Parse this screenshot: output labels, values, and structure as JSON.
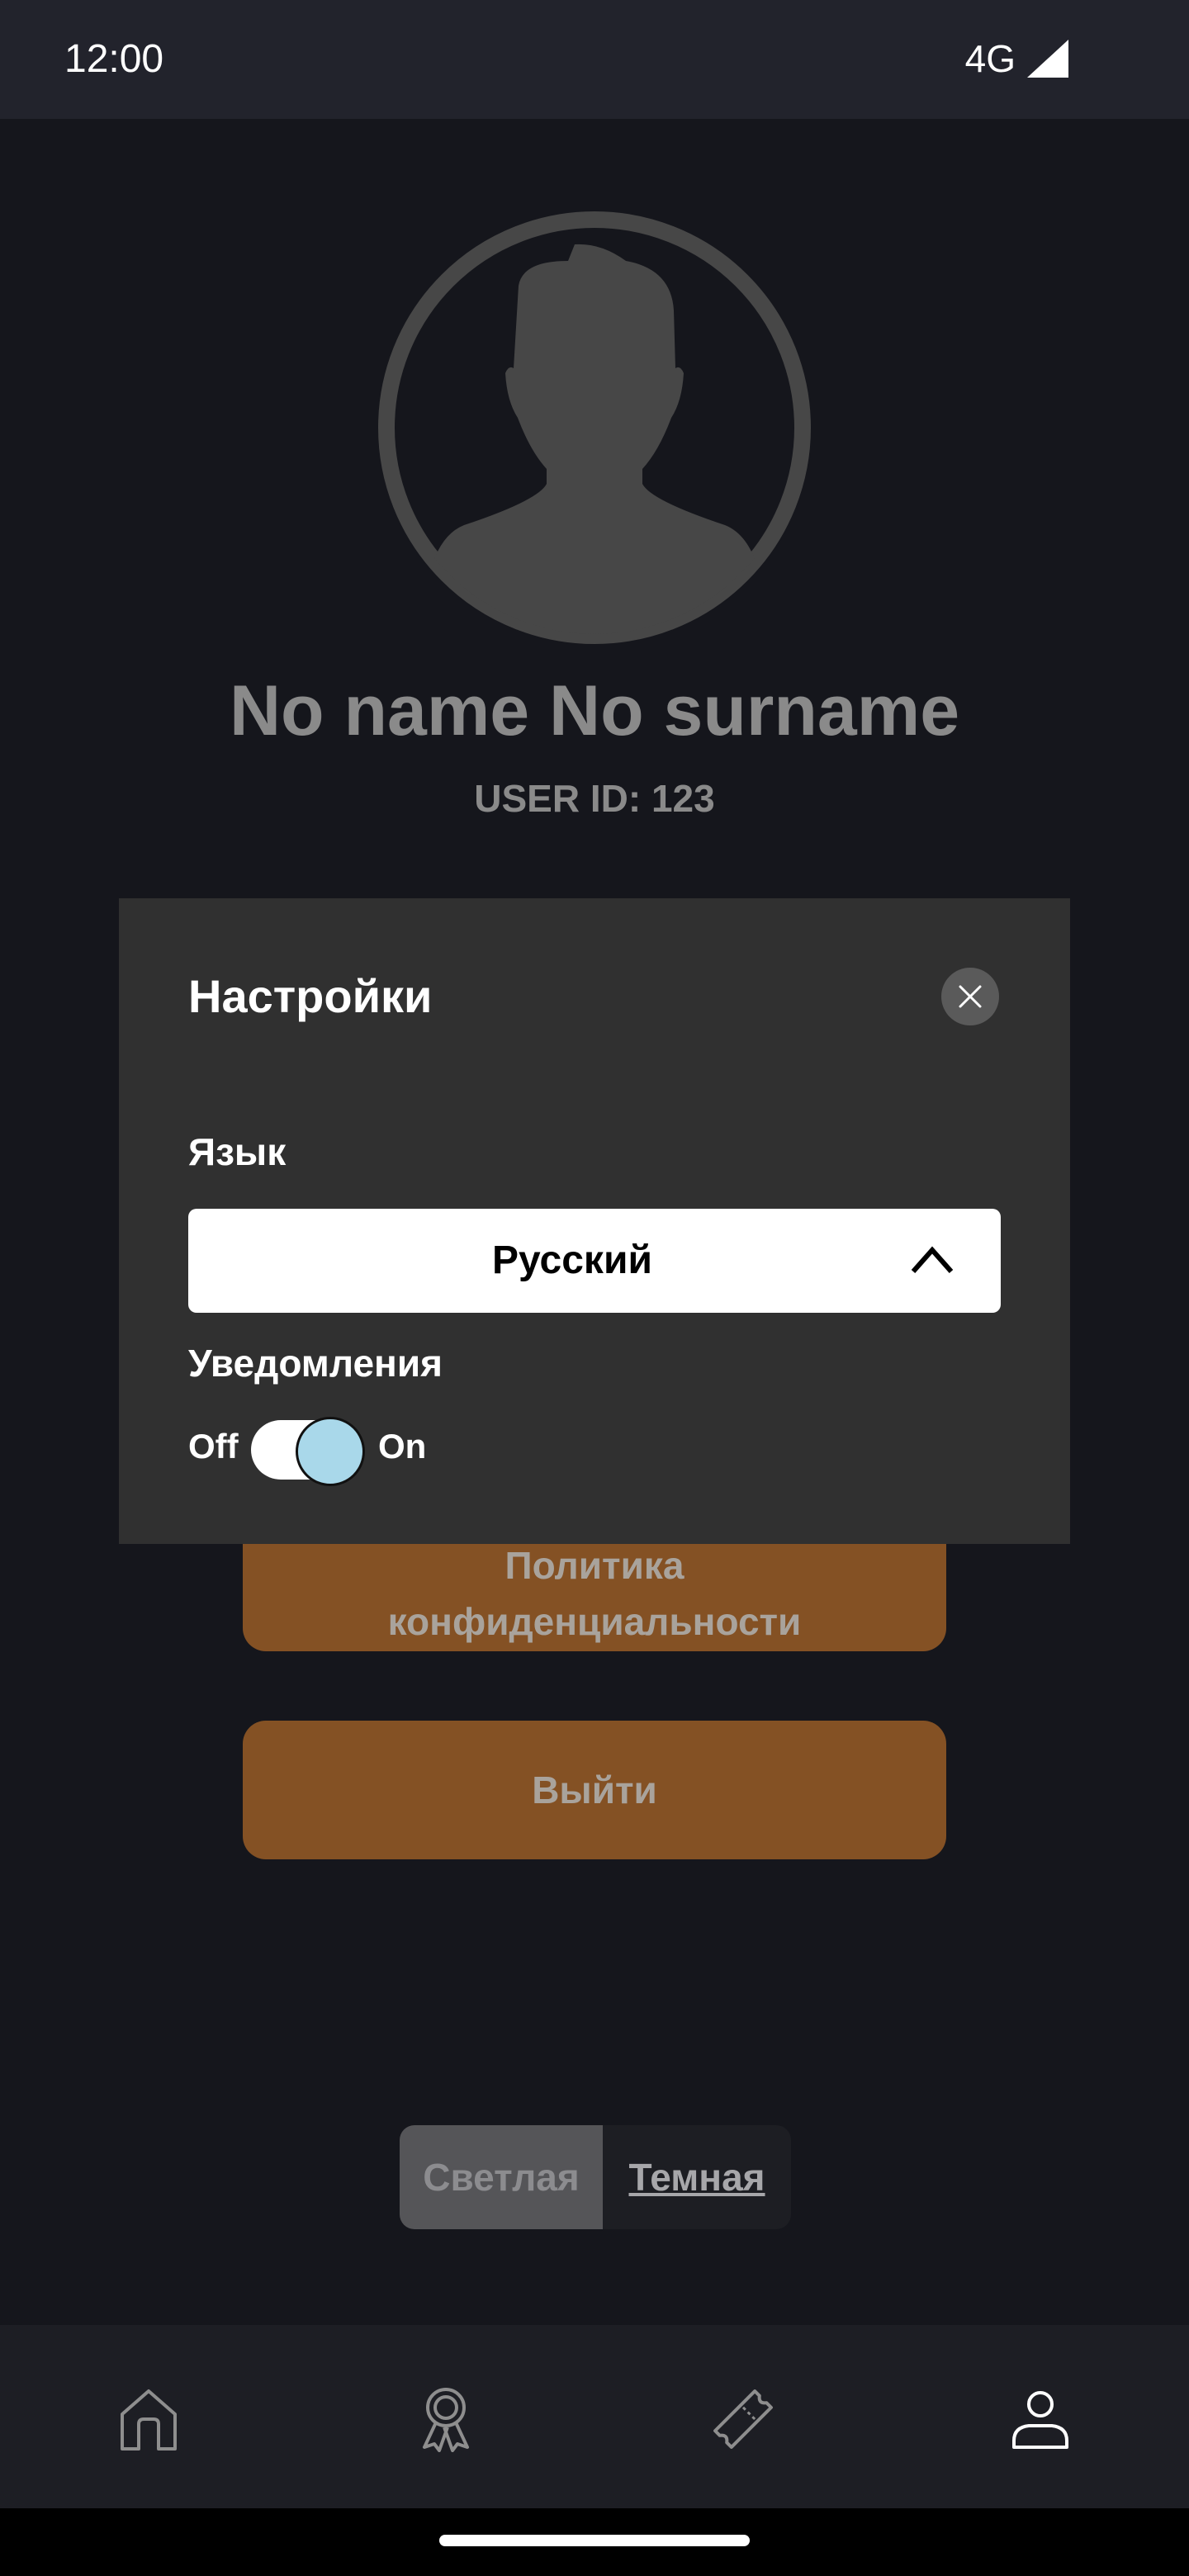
{
  "status_bar": {
    "time": "12:00",
    "network": "4G"
  },
  "profile": {
    "name": "No name No surname",
    "user_id": "USER ID: 123"
  },
  "buttons": {
    "privacy_line1": "Политика",
    "privacy_line2": "конфиденциальности",
    "logout": "Выйти"
  },
  "theme": {
    "light": "Светлая",
    "dark": "Темная",
    "selected": "dark"
  },
  "settings_dialog": {
    "title": "Настройки",
    "language_label": "Язык",
    "language_value": "Русский",
    "notifications_label": "Уведомления",
    "toggle_off": "Off",
    "toggle_on": "On",
    "notifications_enabled": true
  },
  "bottom_nav": {
    "items": [
      {
        "icon": "home-icon"
      },
      {
        "icon": "award-icon"
      },
      {
        "icon": "ticket-icon"
      },
      {
        "icon": "profile-icon",
        "active": true
      }
    ]
  },
  "colors": {
    "accent": "#845124",
    "background": "#15161c",
    "dialog": "#303030",
    "toggle_knob": "#a9d8ea"
  }
}
